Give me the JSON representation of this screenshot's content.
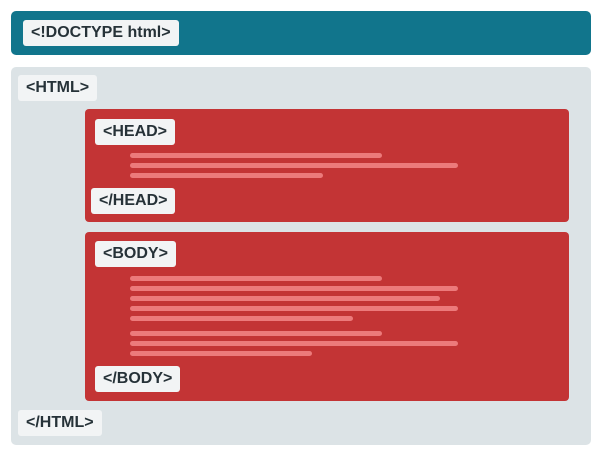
{
  "doctype": {
    "label": "<!DOCTYPE html>"
  },
  "html": {
    "open": "<HTML>",
    "close": "</HTML>"
  },
  "head": {
    "open": "<HEAD>",
    "close": "</HEAD>"
  },
  "body": {
    "open": "<BODY>",
    "close": "</BODY>"
  },
  "colors": {
    "doctype_bar": "#11758c",
    "html_container": "#dce3e6",
    "section": "#c33435",
    "placeholder_line": "#ec7a7b",
    "tag_background": "#f2f4f5",
    "tag_text": "#263238"
  }
}
